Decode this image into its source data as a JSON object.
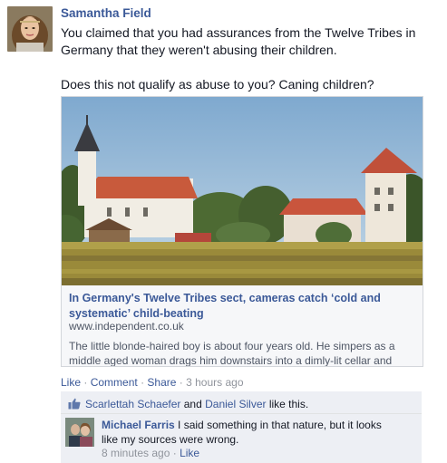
{
  "post": {
    "author": "Samantha Field",
    "paragraphs": [
      "You claimed that you had assurances from the Twelve Tribes in Germany that they weren't abusing their children.",
      "Does this not qualify as abuse to you? Caning children?"
    ],
    "link": {
      "title": "In Germany's Twelve Tribes sect, cameras catch ‘cold and systematic’ child-beating",
      "domain": "www.independent.co.uk",
      "description": "The little blonde-haired boy is about four years old. He simpers as a middle aged woman drags him downstairs into a dimly-lit cellar and"
    },
    "actions": {
      "like": "Like",
      "comment": "Comment",
      "share": "Share",
      "timestamp": "3 hours ago",
      "separator": "·"
    }
  },
  "likes": {
    "user1": "Scarlettah Schaefer",
    "conjunction": "and",
    "user2": "Daniel Silver",
    "suffix": "like this."
  },
  "comment": {
    "author": "Michael Farris",
    "text": "I said something in that nature, but it looks like my sources were wrong.",
    "timestamp": "8 minutes ago",
    "separator": "·",
    "like": "Like"
  },
  "colors": {
    "link_blue": "#3b5998",
    "ufi_background": "#edeff4",
    "meta_gray": "#90949c"
  }
}
